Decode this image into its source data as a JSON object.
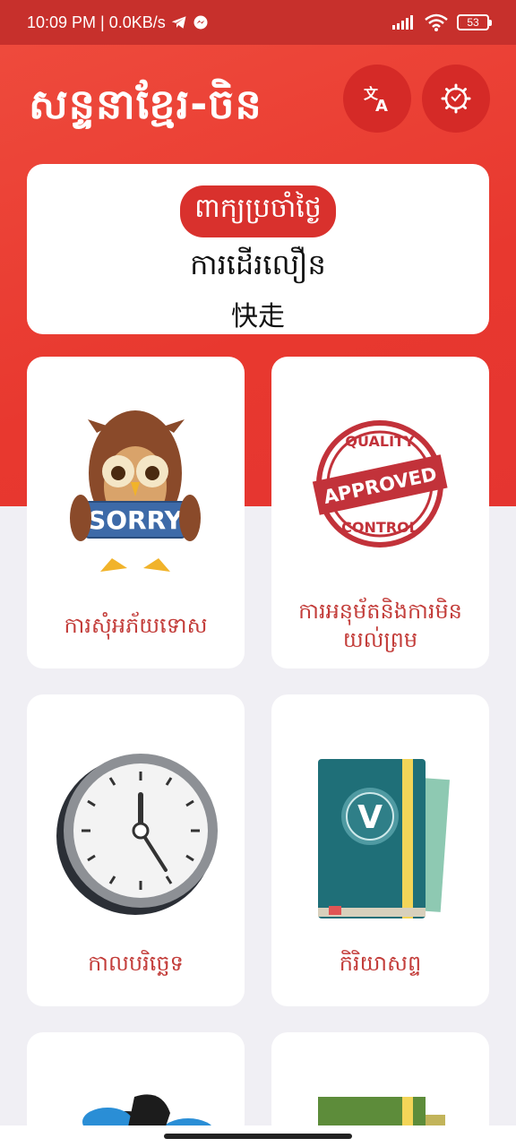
{
  "status_bar": {
    "time_info": "10:09 PM | 0.0KB/s",
    "battery": "53"
  },
  "header": {
    "title": "សន្ទនាខ្មែរ-ចិន",
    "translate_icon": "translate-icon",
    "settings_icon": "gear-icon"
  },
  "daily": {
    "badge": "ពាក្យប្រចាំថ្ងៃ",
    "khmer": "ការដើរលឿន",
    "chinese": "快走"
  },
  "categories": [
    {
      "label": "ការសុំអភ័យទោស",
      "icon": "sorry-owl-icon",
      "sign_text": "SORRY"
    },
    {
      "label": "ការអនុម័តនិងការមិនយល់ព្រម",
      "icon": "approved-stamp-icon",
      "stamp_top": "QUALITY",
      "stamp_mid": "APPROVED",
      "stamp_bottom": "CONTROL"
    },
    {
      "label": "កាលបរិច្ឆេទ",
      "icon": "clock-icon"
    },
    {
      "label": "កិរិយាសព្ទ",
      "icon": "verb-book-icon",
      "book_letter": "V"
    },
    {
      "label": "",
      "icon": "animal-icon"
    },
    {
      "label": "",
      "icon": "book-icon"
    }
  ],
  "colors": {
    "primary": "#e8382f",
    "status": "#c7302c",
    "label": "#c33d3a"
  }
}
